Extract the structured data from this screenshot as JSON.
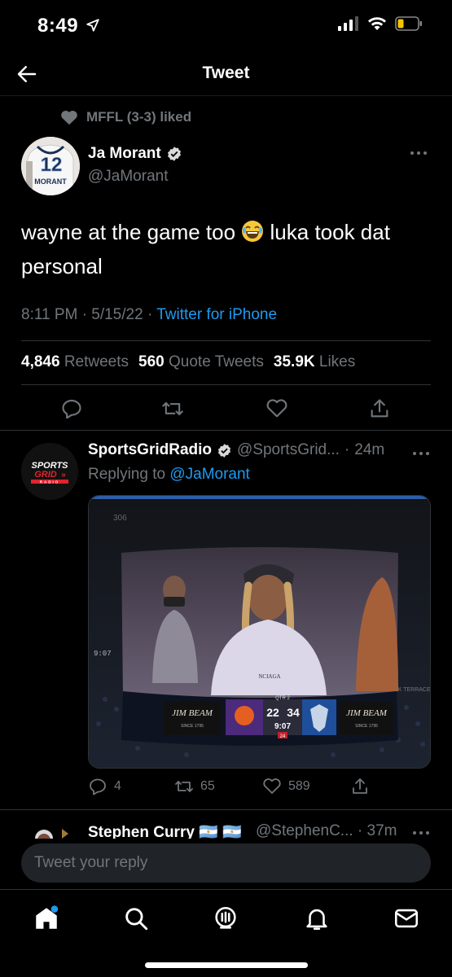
{
  "status": {
    "time": "8:49"
  },
  "header": {
    "title": "Tweet"
  },
  "social_context": {
    "text": "MFFL (3-3) liked"
  },
  "tweet": {
    "author_name": "Ja Morant",
    "author_handle": "@JaMorant",
    "avatar_jersey_number": "12",
    "avatar_jersey_name": "MORANT",
    "text_before_emoji": "wayne at the game too ",
    "text_after_emoji": " luka took dat personal",
    "time": "8:11 PM",
    "date": "5/15/22",
    "source": "Twitter for iPhone",
    "retweets_count": "4,846",
    "retweets_label": "Retweets",
    "quotes_count": "560",
    "quotes_label": "Quote Tweets",
    "likes_count": "35.9K",
    "likes_label": "Likes"
  },
  "reply": {
    "name": "SportsGridRadio",
    "handle": "@SportsGrid...",
    "age": "24m",
    "replying_prefix": "Replying to",
    "replying_to": "@JaMorant",
    "avatar_text_top": "SPORTS",
    "avatar_text_mid": "GRID",
    "avatar_text_bottom": "RADIO",
    "reply_count": "4",
    "retweet_count": "65",
    "like_count": "589",
    "media": {
      "brand_left": "JIM BEAM",
      "brand_right": "JIM BEAM",
      "since": "SINCE 1795",
      "score_home": "22",
      "score_away": "34",
      "quarter": "QTR 2",
      "clock": "9:07",
      "shot_clock": "24",
      "arena_sign": "ANK TERRACE",
      "section": "306",
      "side_clock": "9:07"
    }
  },
  "next_reply": {
    "name": "Stephen Curry",
    "flags": "🇦🇷 🇦🇷",
    "handle": "@StephenC...",
    "age": "37m"
  },
  "compose": {
    "placeholder": "Tweet your reply"
  },
  "colors": {
    "accent": "#1d9bf0",
    "muted": "#71767b",
    "background": "#000000"
  }
}
